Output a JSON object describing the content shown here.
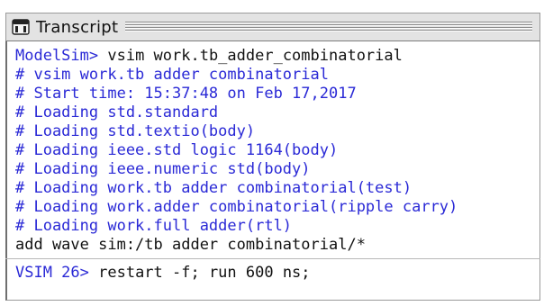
{
  "window": {
    "title": "Transcript"
  },
  "transcript": {
    "lines": [
      {
        "prefix": "ModelSim> ",
        "text": "vsim work.tb_adder_combinatorial"
      },
      {
        "text": "# vsim work.tb adder combinatorial"
      },
      {
        "text": "# Start time: 15:37:48 on Feb 17,2017"
      },
      {
        "text": "# Loading std.standard"
      },
      {
        "text": "# Loading std.textio(body)"
      },
      {
        "text": "# Loading ieee.std logic 1164(body)"
      },
      {
        "text": "# Loading ieee.numeric std(body)"
      },
      {
        "text": "# Loading work.tb adder combinatorial(test)"
      },
      {
        "text": "# Loading work.adder combinatorial(ripple carry)"
      },
      {
        "text": "# Loading work.full adder(rtl)"
      },
      {
        "text": "add wave sim:/tb adder combinatorial/*"
      }
    ],
    "prompt": {
      "prefix": "VSIM 26> ",
      "text": "restart -f; run 600 ns;"
    }
  },
  "colors": {
    "prompt_blue": "#2a29d6",
    "command_black": "#111111",
    "titlebar_bg": "#e3e3e3"
  },
  "icons": {
    "title_icon": "transcript-window-icon"
  }
}
